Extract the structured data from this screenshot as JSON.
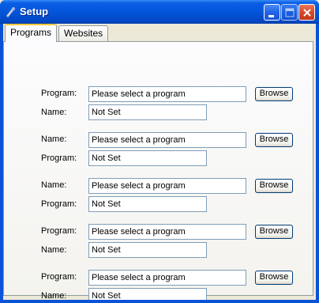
{
  "window": {
    "title": "Setup"
  },
  "tabs": [
    {
      "label": "Programs",
      "active": true
    },
    {
      "label": "Websites",
      "active": false
    }
  ],
  "rows": [
    {
      "label1": "Program:",
      "label2": "Name:",
      "program_value": "Please select a program",
      "name_value": "Not Set",
      "browse_label": "Browse"
    },
    {
      "label1": "Name:",
      "label2": "Program:",
      "program_value": "Please select a program",
      "name_value": "Not Set",
      "browse_label": "Browse"
    },
    {
      "label1": "Name:",
      "label2": "Program:",
      "program_value": "Please select a program",
      "name_value": "Not Set",
      "browse_label": "Browse"
    },
    {
      "label1": "Program:",
      "label2": "Name:",
      "program_value": "Please select a program",
      "name_value": "Not Set",
      "browse_label": "Browse"
    },
    {
      "label1": "Program:",
      "label2": "Name:",
      "program_value": "Please select a program",
      "name_value": "Not Set",
      "browse_label": "Browse"
    }
  ],
  "colors": {
    "titlebar": "#0353d8",
    "close_button": "#d9472a",
    "tab_highlight": "#ffc83c",
    "field_border": "#7f9db9"
  }
}
